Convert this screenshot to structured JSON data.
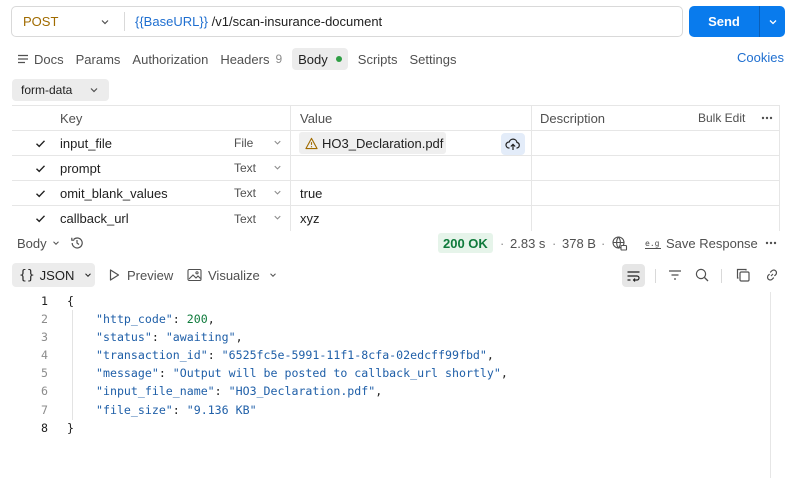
{
  "request": {
    "method": "POST",
    "url_var": "{{BaseURL}}",
    "url_path": " /v1/scan-insurance-document",
    "send_label": "Send"
  },
  "tabs": [
    {
      "label": "Docs"
    },
    {
      "label": "Params"
    },
    {
      "label": "Authorization"
    },
    {
      "label": "Headers",
      "badge": "9"
    },
    {
      "label": "Body",
      "active": true
    },
    {
      "label": "Scripts"
    },
    {
      "label": "Settings"
    }
  ],
  "cookies_label": "Cookies",
  "body_mode": "form-data",
  "table": {
    "headers": {
      "key": "Key",
      "value": "Value",
      "description": "Description",
      "bulk_edit": "Bulk Edit"
    },
    "rows": [
      {
        "key": "input_file",
        "type": "File",
        "value": "HO3_Declaration.pdf"
      },
      {
        "key": "prompt",
        "type": "Text",
        "value": ""
      },
      {
        "key": "omit_blank_values",
        "type": "Text",
        "value": "true"
      },
      {
        "key": "callback_url",
        "type": "Text",
        "value": "xyz"
      }
    ]
  },
  "response": {
    "section_label": "Body",
    "status": "200 OK",
    "time": "2.83 s",
    "size": "378 B",
    "save_label": "Save Response",
    "format": "JSON",
    "preview_label": "Preview",
    "visualize_label": "Visualize"
  },
  "code": {
    "line_numbers": [
      "1",
      "2",
      "3",
      "4",
      "5",
      "6",
      "7",
      "8"
    ],
    "open_brace": "{",
    "close_brace": "}",
    "fields": [
      {
        "key": "\"http_code\"",
        "value": "200",
        "kind": "num"
      },
      {
        "key": "\"status\"",
        "value": "\"awaiting\"",
        "kind": "str"
      },
      {
        "key": "\"transaction_id\"",
        "value": "\"6525fc5e-5991-11f1-8cfa-02edcff99fbd\"",
        "kind": "str"
      },
      {
        "key": "\"message\"",
        "value": "\"Output will be posted to callback_url shortly\"",
        "kind": "str"
      },
      {
        "key": "\"input_file_name\"",
        "value": "\"HO3_Declaration.pdf\"",
        "kind": "str"
      },
      {
        "key": "\"file_size\"",
        "value": "\"9.136 KB\"",
        "kind": "str"
      }
    ]
  },
  "colors": {
    "send": "#097bed",
    "method": "#a06b00",
    "status_ok_bg": "#e6f4ea",
    "status_ok_text": "#0e7a3b",
    "json_string": "#1f5fa8",
    "json_number": "#0e7a3b"
  }
}
